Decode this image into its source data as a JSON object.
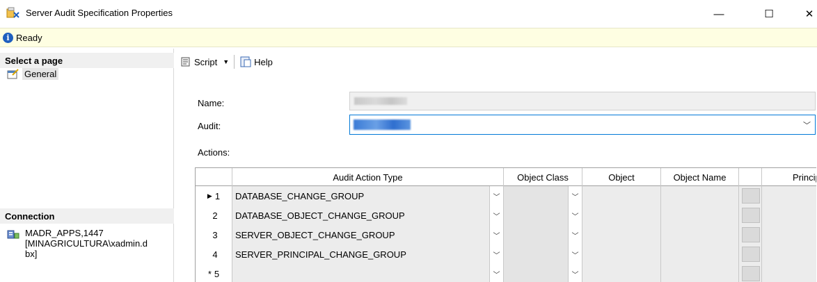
{
  "window": {
    "title": "Server Audit Specification Properties",
    "minimize_glyph": "—",
    "maximize_glyph": "☐",
    "close_glyph": "✕"
  },
  "status": {
    "text": "Ready",
    "icon": "info-icon"
  },
  "left_pane": {
    "select_page_header": "Select a page",
    "pages": [
      {
        "label": "General",
        "icon": "general-page-icon"
      }
    ],
    "connection_header": "Connection",
    "connection": {
      "text": "MADR_APPS,1447\n[MINAGRICULTURA\\xadmin.d\nbx]",
      "icon": "server-connection-icon"
    }
  },
  "toolbar": {
    "script_label": "Script",
    "help_label": "Help"
  },
  "form": {
    "name_label": "Name:",
    "audit_label": "Audit:",
    "actions_label": "Actions:"
  },
  "grid": {
    "columns": [
      "Audit Action Type",
      "Object Class",
      "Object",
      "Object Name",
      "",
      "Principal"
    ],
    "rows": [
      {
        "num": "1",
        "marker": "▶",
        "type": "DATABASE_CHANGE_GROUP"
      },
      {
        "num": "2",
        "marker": "",
        "type": "DATABASE_OBJECT_CHANGE_GROUP"
      },
      {
        "num": "3",
        "marker": "",
        "type": "SERVER_OBJECT_CHANGE_GROUP"
      },
      {
        "num": "4",
        "marker": "",
        "type": "SERVER_PRINCIPAL_CHANGE_GROUP"
      },
      {
        "num": "5",
        "marker": "*",
        "type": ""
      }
    ]
  }
}
